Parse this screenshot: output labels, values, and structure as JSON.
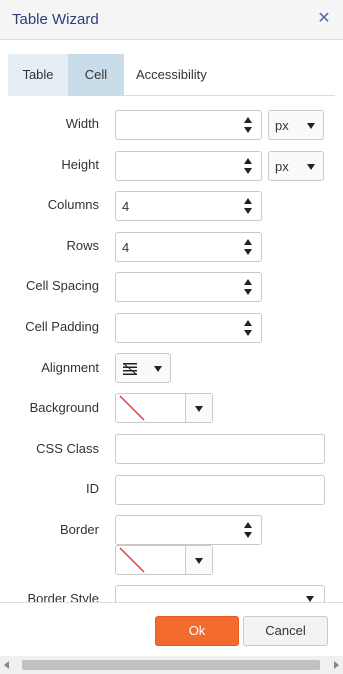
{
  "window": {
    "title": "Table Wizard",
    "close_icon": "close-icon"
  },
  "tabs": [
    {
      "label": "Table"
    },
    {
      "label": "Cell"
    },
    {
      "label": "Accessibility"
    }
  ],
  "active_tab": "Cell",
  "fields": {
    "width": {
      "label": "Width",
      "value": "",
      "unit": "px"
    },
    "height": {
      "label": "Height",
      "value": "",
      "unit": "px"
    },
    "columns": {
      "label": "Columns",
      "value": "4"
    },
    "rows": {
      "label": "Rows",
      "value": "4"
    },
    "cell_spacing": {
      "label": "Cell Spacing",
      "value": ""
    },
    "cell_padding": {
      "label": "Cell Padding",
      "value": ""
    },
    "alignment": {
      "label": "Alignment",
      "icon": "align-icon"
    },
    "background": {
      "label": "Background",
      "color": "none"
    },
    "css_class": {
      "label": "CSS Class",
      "value": ""
    },
    "id": {
      "label": "ID",
      "value": ""
    },
    "border": {
      "label": "Border",
      "value": "",
      "color": "none"
    },
    "border_style": {
      "label": "Border Style",
      "value": ""
    }
  },
  "buttons": {
    "ok": "Ok",
    "cancel": "Cancel"
  },
  "colors": {
    "title": "#2f3e7a",
    "ok_bg": "#f26a2d",
    "tab_active_bg": "#c8dce9",
    "tab_inactive_bg": "#e6eef5",
    "no_color_slash": "#e0393e"
  }
}
